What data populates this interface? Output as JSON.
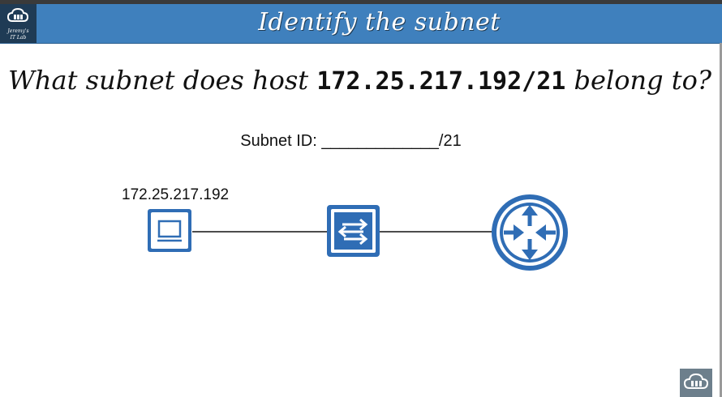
{
  "header": {
    "title": "Identify the subnet",
    "logo_line1": "Jeremy's",
    "logo_line2": "IT Lab"
  },
  "question": {
    "prefix": "What subnet does host ",
    "ip": "172.25.217.192/21",
    "suffix": " belong to?"
  },
  "answer": {
    "label": "Subnet ID: ",
    "blank": "_____________",
    "suffix": "/21"
  },
  "diagram": {
    "host_ip": "172.25.217.192",
    "devices": [
      "pc-icon",
      "switch-icon",
      "router-icon"
    ]
  },
  "colors": {
    "title_bar": "#3f80bd",
    "logo_bg": "#1f3b55",
    "device_blue": "#2f6db5"
  }
}
